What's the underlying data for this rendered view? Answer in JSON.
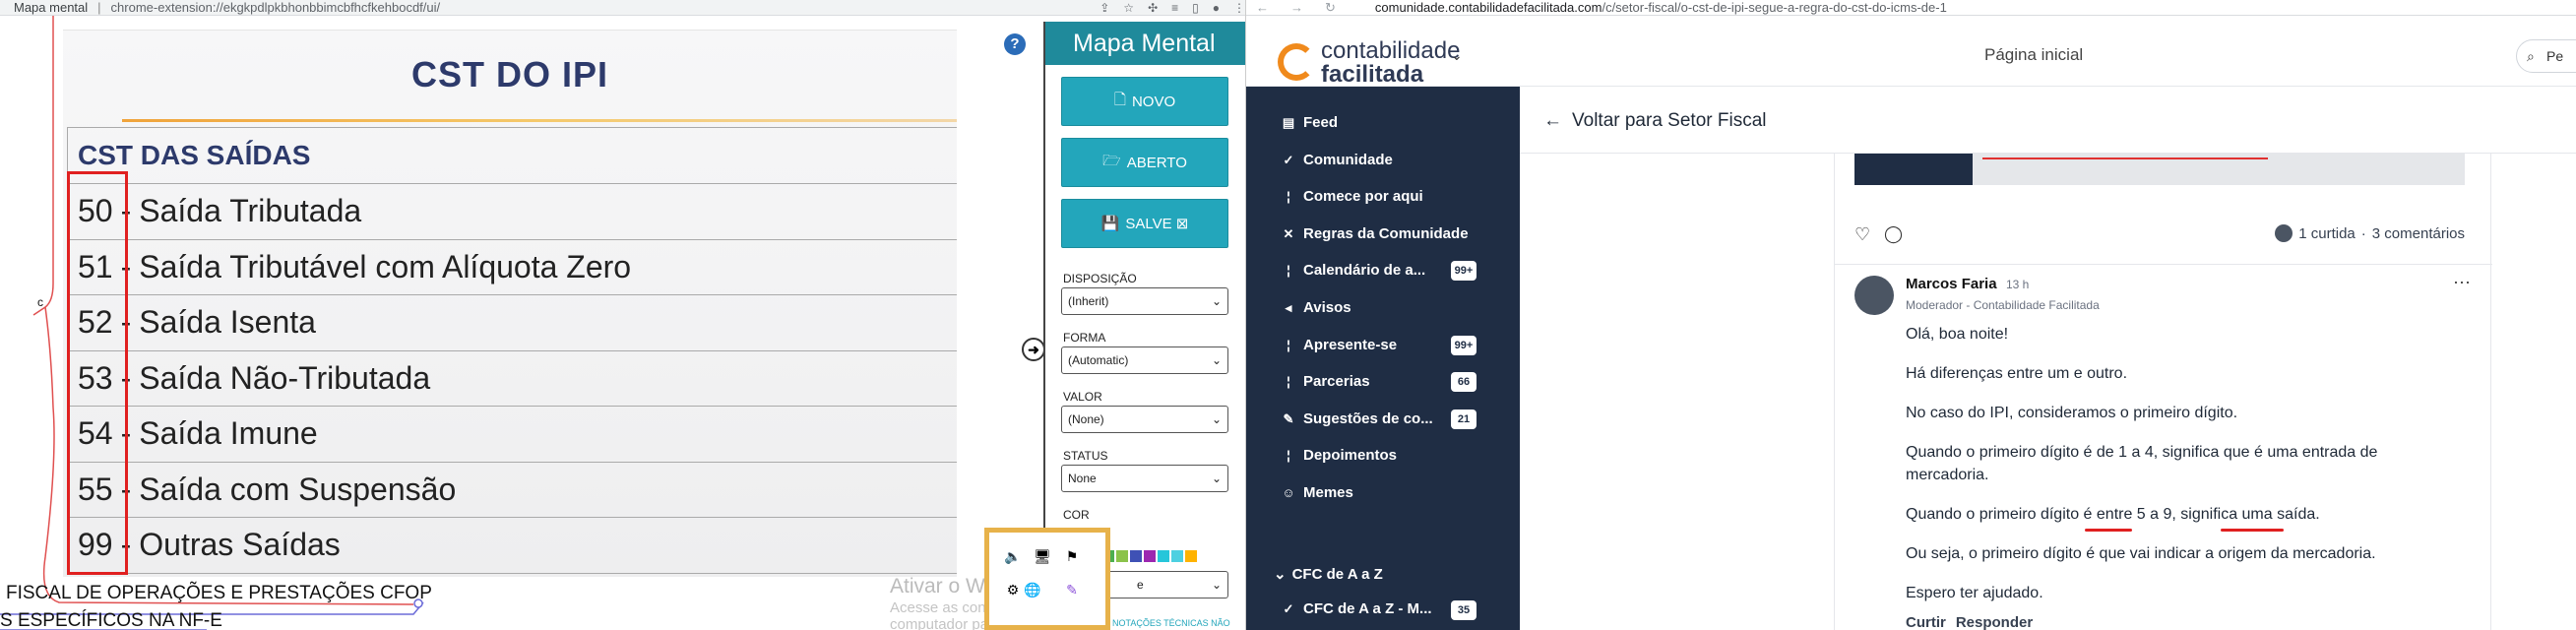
{
  "left_browser": {
    "tab_title": "Mapa mental",
    "separator": "|",
    "url": "chrome-extension://ekgkpdlpkbhonbbimcbfhcfkehbocdf/ui/"
  },
  "cst_image": {
    "title": "CST DO IPI",
    "header": "CST DAS SAÍDAS",
    "rows": [
      {
        "code": "50",
        "dash": "-",
        "label": "Saída Tributada"
      },
      {
        "code": "51",
        "dash": "-",
        "label": "Saída Tributável com Alíquota Zero"
      },
      {
        "code": "52",
        "dash": "-",
        "label": "Saída Isenta"
      },
      {
        "code": "53",
        "dash": "-",
        "label": "Saída Não-Tributada"
      },
      {
        "code": "54",
        "dash": "-",
        "label": "Saída Imune"
      },
      {
        "code": "55",
        "dash": "-",
        "label": "Saída com Suspensão"
      },
      {
        "code": "99",
        "dash": "-",
        "label": "Outras Saídas"
      }
    ]
  },
  "mindmap": {
    "node_c": "c",
    "node_1": "FISCAL DE OPERAÇÕES E PRESTAÇÕES CFOP",
    "node_2": "S ESPECÍFICOS NA NF-E"
  },
  "watermark": {
    "title": "Ativar o Windows",
    "subtitle": "Acesse as configurações do computador para ativar o Windows."
  },
  "panel": {
    "help": "?",
    "collapse": "➜",
    "title": "Mapa Mental",
    "btn_new": "NOVO",
    "btn_open": "ABERTO",
    "btn_save": "SALVE ⊠",
    "label_layout": "DISPOSIÇÃO",
    "value_layout": "(Inherit)",
    "label_shape": "FORMA",
    "value_shape": "(Automatic)",
    "label_value": "VALOR",
    "value_value": "(None)",
    "label_status": "STATUS",
    "value_status": "None",
    "label_color": "COR",
    "swatch_colors": [
      "#e53935",
      "#4caf50",
      "#8bc34a",
      "#3f51b5",
      "#9c27b0",
      "#26c6da",
      "#4dd0e1",
      "#ffb300"
    ],
    "value_bottom": "e",
    "footer_note": "NOTAÇÕES TÉCNICAS NÃO"
  },
  "right_browser": {
    "domain": "comunidade.contabilidadefacilitada.com",
    "path": "/c/setor-fiscal/o-cst-de-ipi-segue-a-regra-do-cst-do-icms-de-1"
  },
  "site": {
    "logo_line1": "contabilidade",
    "logo_line2": "facilitada",
    "home": "Página inicial",
    "search": "Pe"
  },
  "sidebar": {
    "items": [
      {
        "label": "Feed",
        "icon": "feed-icon",
        "glyph": "▤",
        "count": ""
      },
      {
        "label": "Comunidade",
        "icon": "check-icon",
        "glyph": "✓",
        "count": ""
      },
      {
        "label": "Comece por aqui",
        "icon": "pin-icon",
        "glyph": "¦",
        "count": ""
      },
      {
        "label": "Regras da Comunidade",
        "icon": "close-icon",
        "glyph": "✕",
        "count": ""
      },
      {
        "label": "Calendário de a...",
        "icon": "info-icon",
        "glyph": "¦",
        "count": "99+"
      },
      {
        "label": "Avisos",
        "icon": "megaphone-icon",
        "glyph": "◂",
        "count": ""
      },
      {
        "label": "Apresente-se",
        "icon": "info-icon",
        "glyph": "¦",
        "count": "99+"
      },
      {
        "label": "Parcerias",
        "icon": "info-icon",
        "glyph": "¦",
        "count": "66"
      },
      {
        "label": "Sugestões de co...",
        "icon": "note-icon",
        "glyph": "✎",
        "count": "21"
      },
      {
        "label": "Depoimentos",
        "icon": "info-icon",
        "glyph": "¦",
        "count": ""
      },
      {
        "label": "Memes",
        "icon": "smile-icon",
        "glyph": "☺",
        "count": ""
      }
    ],
    "section": "CFC de A a Z",
    "section_item": "CFC de A a Z - M...",
    "section_item_count": "35"
  },
  "post": {
    "back": "Voltar para Setor Fiscal",
    "likes": "1 curtida",
    "dot": "·",
    "comments": "3 comentários",
    "commenter": "Marcos Faria",
    "time": "13 h",
    "role": "Moderador - Contabilidade Facilitada",
    "menu": "···",
    "paragraphs": [
      "Olá, boa noite!",
      "Há diferenças entre um e outro.",
      "No caso do IPI, consideramos o primeiro dígito.",
      "Quando o primeiro dígito é de 1 a 4, significa que é uma entrada de",
      "mercadoria.",
      "Quando o primeiro dígito é entre 5 a 9, significa uma saída.",
      "Ou seja, o primeiro dígito é que vai indicar a origem da mercadoria.",
      "Espero ter ajudado."
    ],
    "action_like": "Curtir",
    "action_reply": "Responder"
  }
}
